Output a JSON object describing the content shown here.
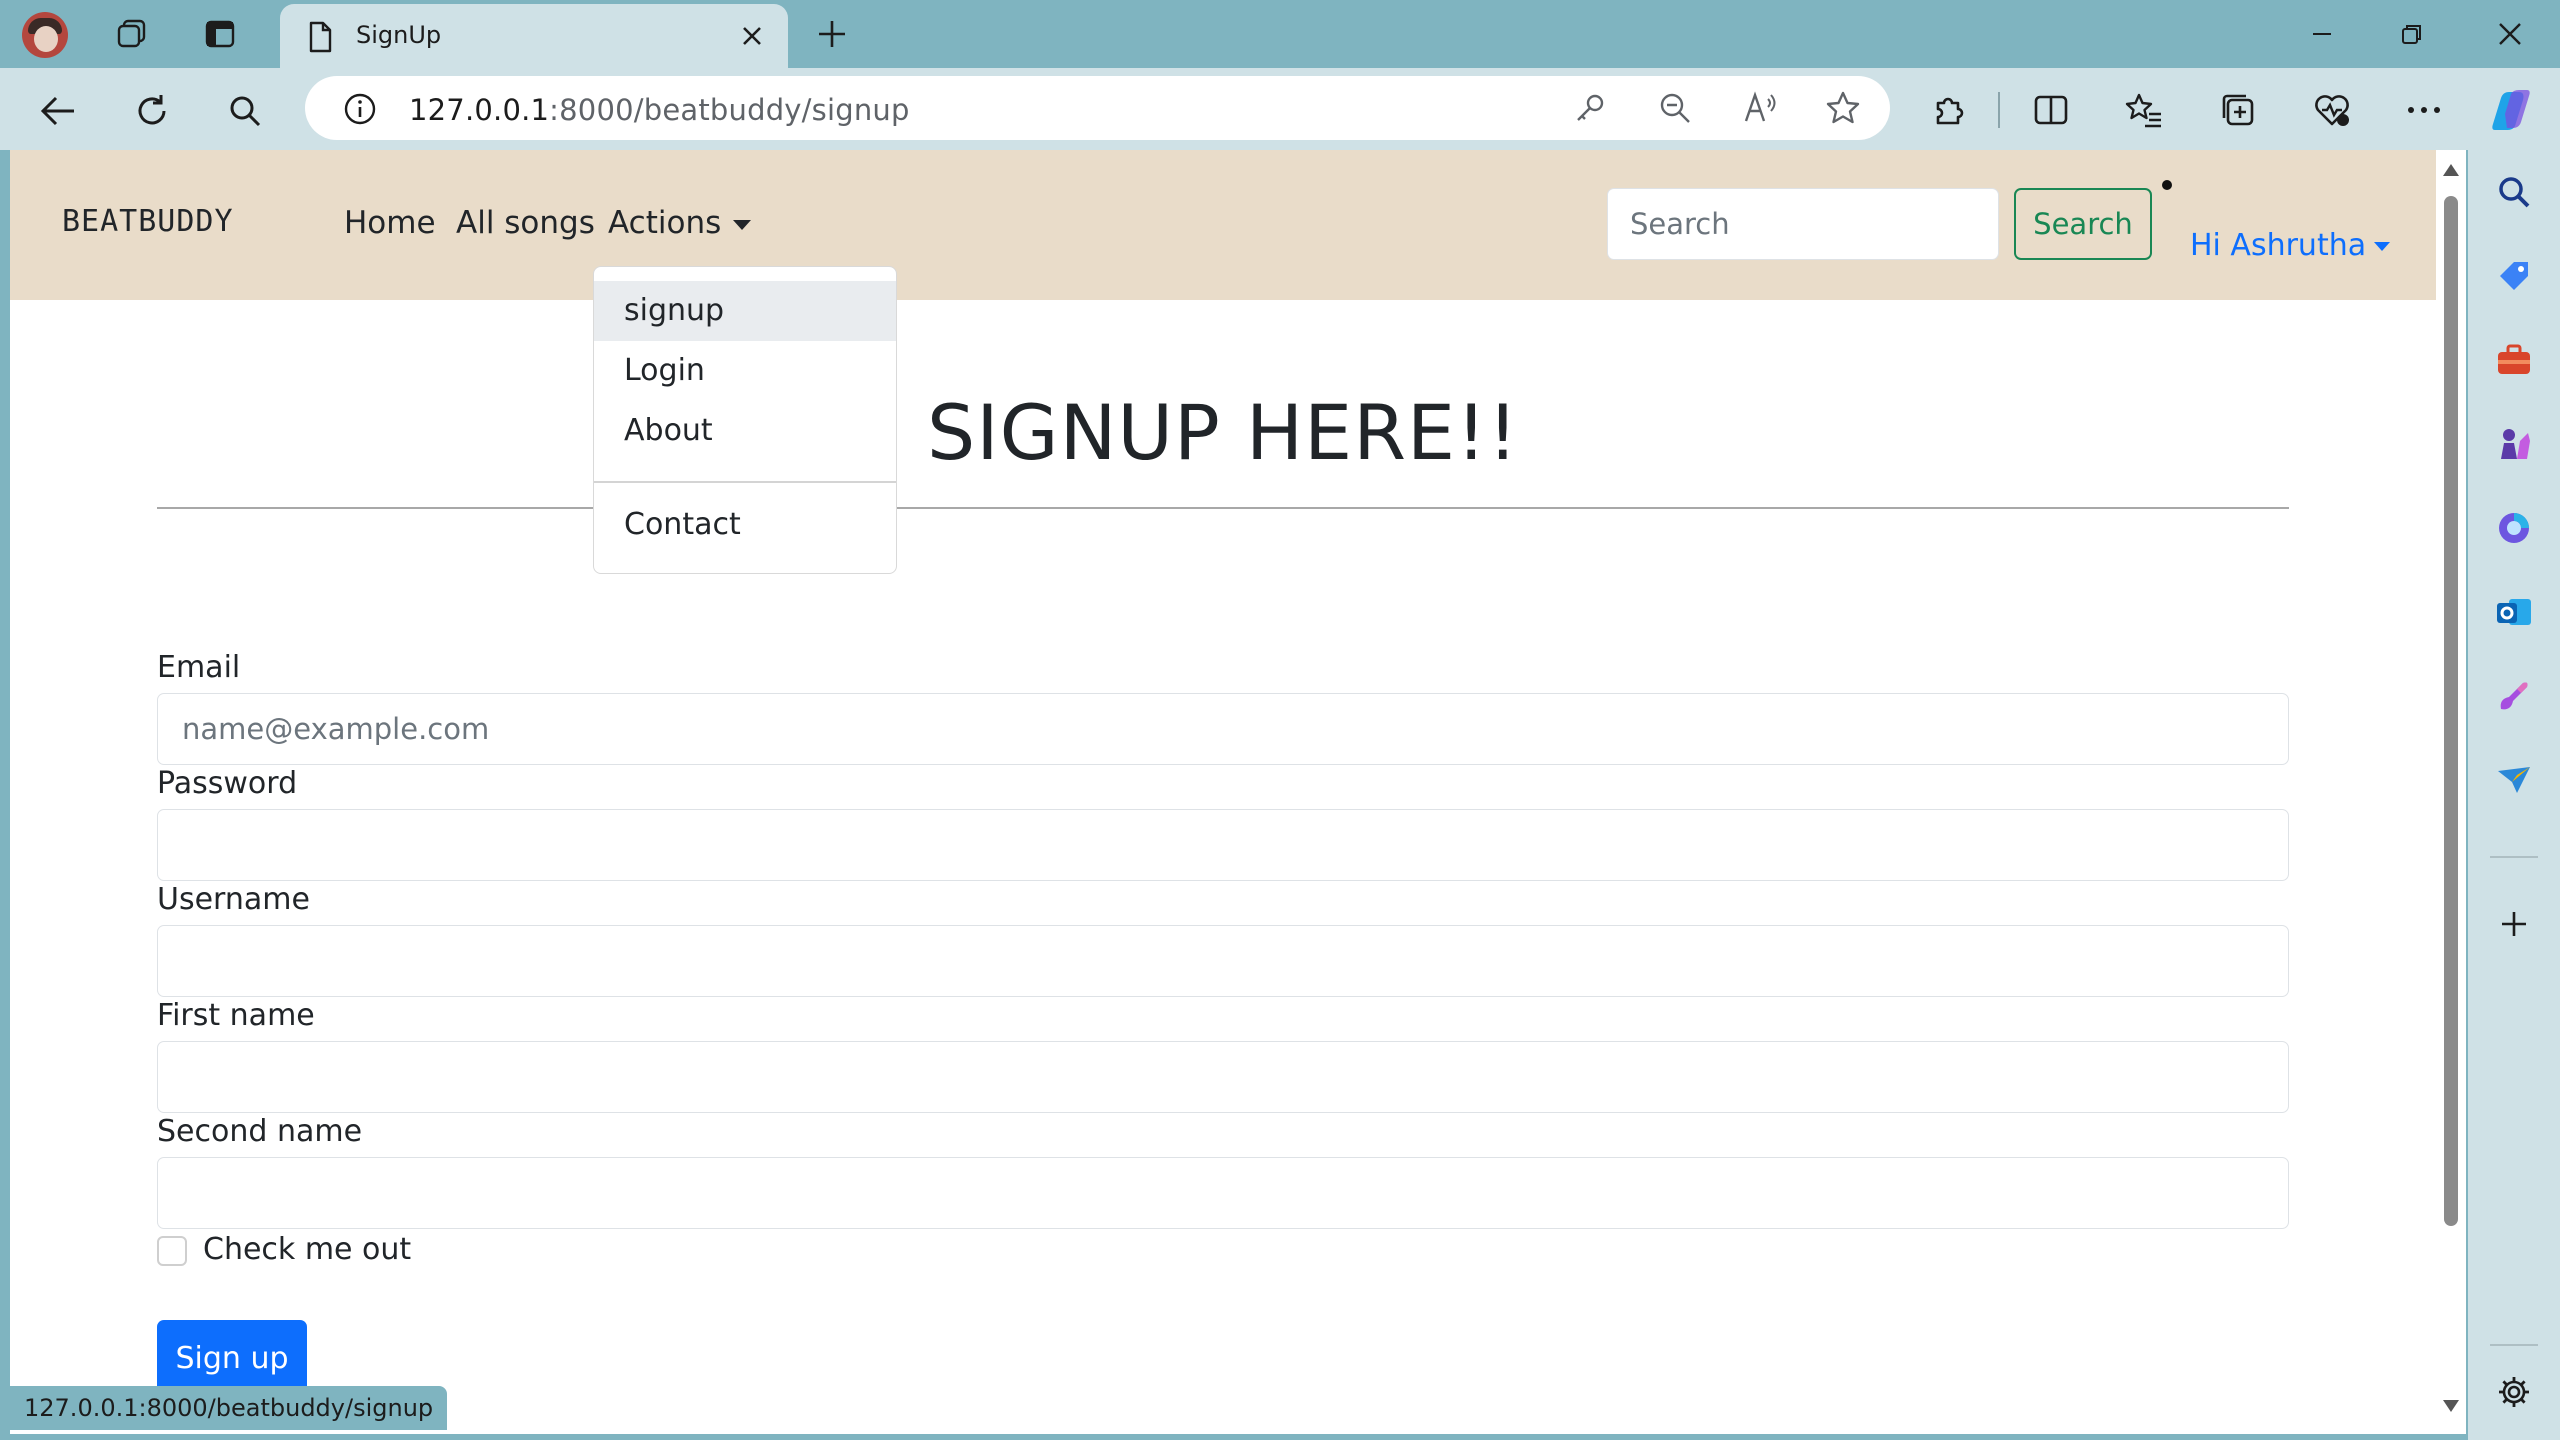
{
  "browser": {
    "tab_title": "SignUp",
    "url_host": "127.0.0.1",
    "url_rest": ":8000/beatbuddy/signup",
    "status_url": "127.0.0.1:8000/beatbuddy/signup"
  },
  "navbar": {
    "brand": "BEATBUDDY",
    "links": [
      "Home",
      "All songs",
      "Actions"
    ],
    "search_placeholder": "Search",
    "search_button": "Search",
    "user_greeting": "Hi Ashrutha"
  },
  "actions_dropdown": {
    "items": [
      "signup",
      "Login",
      "About"
    ],
    "contact": "Contact"
  },
  "page": {
    "heading": "SIGNUP HERE!!",
    "fields": [
      {
        "label": "Email",
        "placeholder": "name@example.com"
      },
      {
        "label": "Password",
        "placeholder": ""
      },
      {
        "label": "Username",
        "placeholder": ""
      },
      {
        "label": "First name",
        "placeholder": ""
      },
      {
        "label": "Second name",
        "placeholder": ""
      }
    ],
    "checkbox_label": "Check me out",
    "submit_label": "Sign up"
  },
  "colors": {
    "navbar_bg": "#e9dcc9",
    "primary": "#0d6efd",
    "success": "#198754",
    "browser_frame": "#7fb4c0"
  }
}
